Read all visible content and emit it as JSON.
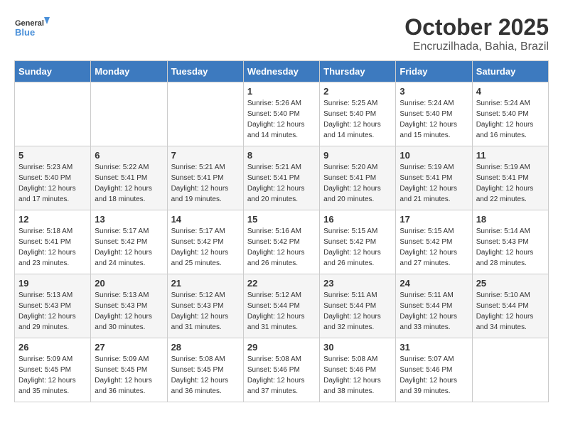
{
  "header": {
    "logo_line1": "General",
    "logo_line2": "Blue",
    "title": "October 2025",
    "subtitle": "Encruzilhada, Bahia, Brazil"
  },
  "days_of_week": [
    "Sunday",
    "Monday",
    "Tuesday",
    "Wednesday",
    "Thursday",
    "Friday",
    "Saturday"
  ],
  "weeks": [
    [
      {
        "day": "",
        "info": ""
      },
      {
        "day": "",
        "info": ""
      },
      {
        "day": "",
        "info": ""
      },
      {
        "day": "1",
        "info": "Sunrise: 5:26 AM\nSunset: 5:40 PM\nDaylight: 12 hours\nand 14 minutes."
      },
      {
        "day": "2",
        "info": "Sunrise: 5:25 AM\nSunset: 5:40 PM\nDaylight: 12 hours\nand 14 minutes."
      },
      {
        "day": "3",
        "info": "Sunrise: 5:24 AM\nSunset: 5:40 PM\nDaylight: 12 hours\nand 15 minutes."
      },
      {
        "day": "4",
        "info": "Sunrise: 5:24 AM\nSunset: 5:40 PM\nDaylight: 12 hours\nand 16 minutes."
      }
    ],
    [
      {
        "day": "5",
        "info": "Sunrise: 5:23 AM\nSunset: 5:40 PM\nDaylight: 12 hours\nand 17 minutes."
      },
      {
        "day": "6",
        "info": "Sunrise: 5:22 AM\nSunset: 5:41 PM\nDaylight: 12 hours\nand 18 minutes."
      },
      {
        "day": "7",
        "info": "Sunrise: 5:21 AM\nSunset: 5:41 PM\nDaylight: 12 hours\nand 19 minutes."
      },
      {
        "day": "8",
        "info": "Sunrise: 5:21 AM\nSunset: 5:41 PM\nDaylight: 12 hours\nand 20 minutes."
      },
      {
        "day": "9",
        "info": "Sunrise: 5:20 AM\nSunset: 5:41 PM\nDaylight: 12 hours\nand 20 minutes."
      },
      {
        "day": "10",
        "info": "Sunrise: 5:19 AM\nSunset: 5:41 PM\nDaylight: 12 hours\nand 21 minutes."
      },
      {
        "day": "11",
        "info": "Sunrise: 5:19 AM\nSunset: 5:41 PM\nDaylight: 12 hours\nand 22 minutes."
      }
    ],
    [
      {
        "day": "12",
        "info": "Sunrise: 5:18 AM\nSunset: 5:41 PM\nDaylight: 12 hours\nand 23 minutes."
      },
      {
        "day": "13",
        "info": "Sunrise: 5:17 AM\nSunset: 5:42 PM\nDaylight: 12 hours\nand 24 minutes."
      },
      {
        "day": "14",
        "info": "Sunrise: 5:17 AM\nSunset: 5:42 PM\nDaylight: 12 hours\nand 25 minutes."
      },
      {
        "day": "15",
        "info": "Sunrise: 5:16 AM\nSunset: 5:42 PM\nDaylight: 12 hours\nand 26 minutes."
      },
      {
        "day": "16",
        "info": "Sunrise: 5:15 AM\nSunset: 5:42 PM\nDaylight: 12 hours\nand 26 minutes."
      },
      {
        "day": "17",
        "info": "Sunrise: 5:15 AM\nSunset: 5:42 PM\nDaylight: 12 hours\nand 27 minutes."
      },
      {
        "day": "18",
        "info": "Sunrise: 5:14 AM\nSunset: 5:43 PM\nDaylight: 12 hours\nand 28 minutes."
      }
    ],
    [
      {
        "day": "19",
        "info": "Sunrise: 5:13 AM\nSunset: 5:43 PM\nDaylight: 12 hours\nand 29 minutes."
      },
      {
        "day": "20",
        "info": "Sunrise: 5:13 AM\nSunset: 5:43 PM\nDaylight: 12 hours\nand 30 minutes."
      },
      {
        "day": "21",
        "info": "Sunrise: 5:12 AM\nSunset: 5:43 PM\nDaylight: 12 hours\nand 31 minutes."
      },
      {
        "day": "22",
        "info": "Sunrise: 5:12 AM\nSunset: 5:44 PM\nDaylight: 12 hours\nand 31 minutes."
      },
      {
        "day": "23",
        "info": "Sunrise: 5:11 AM\nSunset: 5:44 PM\nDaylight: 12 hours\nand 32 minutes."
      },
      {
        "day": "24",
        "info": "Sunrise: 5:11 AM\nSunset: 5:44 PM\nDaylight: 12 hours\nand 33 minutes."
      },
      {
        "day": "25",
        "info": "Sunrise: 5:10 AM\nSunset: 5:44 PM\nDaylight: 12 hours\nand 34 minutes."
      }
    ],
    [
      {
        "day": "26",
        "info": "Sunrise: 5:09 AM\nSunset: 5:45 PM\nDaylight: 12 hours\nand 35 minutes."
      },
      {
        "day": "27",
        "info": "Sunrise: 5:09 AM\nSunset: 5:45 PM\nDaylight: 12 hours\nand 36 minutes."
      },
      {
        "day": "28",
        "info": "Sunrise: 5:08 AM\nSunset: 5:45 PM\nDaylight: 12 hours\nand 36 minutes."
      },
      {
        "day": "29",
        "info": "Sunrise: 5:08 AM\nSunset: 5:46 PM\nDaylight: 12 hours\nand 37 minutes."
      },
      {
        "day": "30",
        "info": "Sunrise: 5:08 AM\nSunset: 5:46 PM\nDaylight: 12 hours\nand 38 minutes."
      },
      {
        "day": "31",
        "info": "Sunrise: 5:07 AM\nSunset: 5:46 PM\nDaylight: 12 hours\nand 39 minutes."
      },
      {
        "day": "",
        "info": ""
      }
    ]
  ]
}
